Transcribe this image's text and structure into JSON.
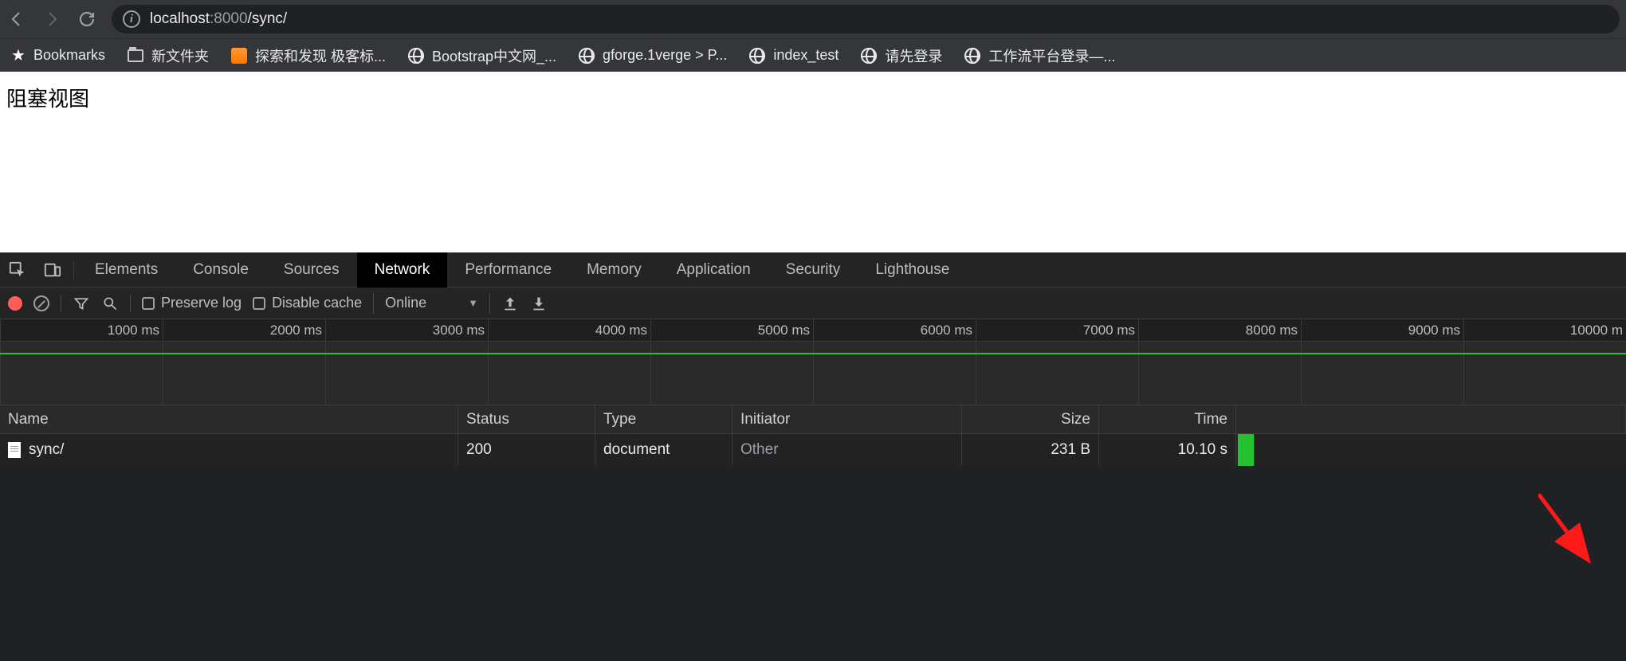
{
  "browser": {
    "url_host": "localhost",
    "url_port": ":8000",
    "url_path": "/sync/",
    "bookmarks_label": "Bookmarks",
    "bookmarks": [
      {
        "icon": "folder",
        "label": "新文件夹"
      },
      {
        "icon": "favicon",
        "label": "探索和发现 极客标..."
      },
      {
        "icon": "globe",
        "label": "Bootstrap中文网_..."
      },
      {
        "icon": "globe",
        "label": "gforge.1verge > P..."
      },
      {
        "icon": "globe",
        "label": "index_test"
      },
      {
        "icon": "globe",
        "label": "请先登录"
      },
      {
        "icon": "globe",
        "label": "工作流平台登录—..."
      }
    ]
  },
  "page": {
    "heading": "阻塞视图"
  },
  "devtools": {
    "tabs": [
      "Elements",
      "Console",
      "Sources",
      "Network",
      "Performance",
      "Memory",
      "Application",
      "Security",
      "Lighthouse"
    ],
    "active_tab": "Network",
    "preserve_log_label": "Preserve log",
    "disable_cache_label": "Disable cache",
    "throttling_label": "Online",
    "timeline_ticks": [
      "1000 ms",
      "2000 ms",
      "3000 ms",
      "4000 ms",
      "5000 ms",
      "6000 ms",
      "7000 ms",
      "8000 ms",
      "9000 ms",
      "10000 m"
    ],
    "columns": {
      "name": "Name",
      "status": "Status",
      "type": "Type",
      "initiator": "Initiator",
      "size": "Size",
      "time": "Time"
    },
    "requests": [
      {
        "name": "sync/",
        "status": "200",
        "type": "document",
        "initiator": "Other",
        "size": "231 B",
        "time": "10.10 s"
      }
    ]
  }
}
